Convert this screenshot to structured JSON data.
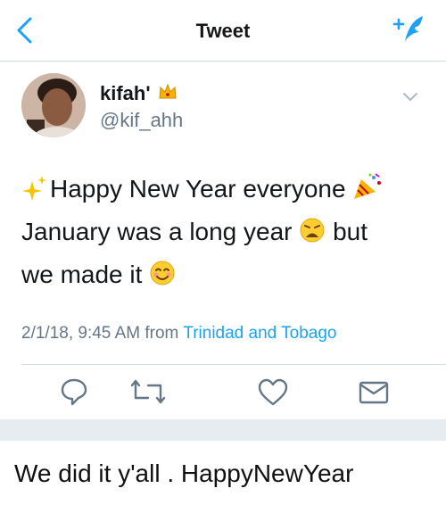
{
  "header": {
    "title": "Tweet"
  },
  "tweet": {
    "user": {
      "name": "kifah'",
      "handle": "@kif_ahh"
    },
    "lines": [
      [
        "Happy New Year everyone"
      ],
      [
        "January was a long year",
        "but"
      ],
      [
        "we made it"
      ]
    ],
    "timestamp": "2/1/18, 9:45 AM from",
    "location": "Trinidad and Tobago"
  },
  "caption": "We did it y'all . HappyNewYear",
  "icons": {
    "back": "chevron-left-icon",
    "compose": "compose-tweet-icon",
    "more": "chevron-down-icon",
    "reply": "reply-icon",
    "retweet": "retweet-icon",
    "like": "heart-icon",
    "dm": "envelope-icon"
  },
  "colors": {
    "accent": "#1da1f2",
    "secondary_text": "#657786",
    "divider": "#d6dde3",
    "separator_band": "#e6ecf0"
  }
}
